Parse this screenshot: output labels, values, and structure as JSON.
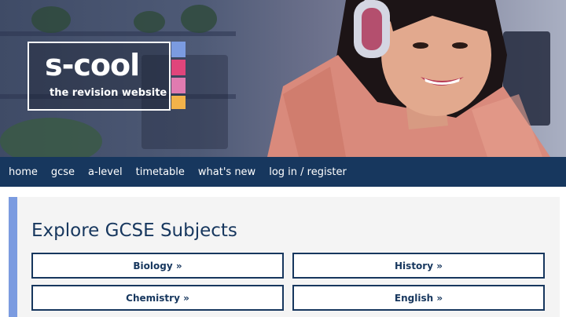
{
  "logo": {
    "name": "s-cool",
    "tagline": "the revision website",
    "strip_colors": [
      "#7b9be0",
      "#e0457b",
      "#e07bb0",
      "#f2b24a"
    ]
  },
  "nav": {
    "items": [
      "home",
      "gcse",
      "a-level",
      "timetable",
      "what's new",
      "log in / register"
    ]
  },
  "main": {
    "heading": "Explore GCSE Subjects",
    "subjects": [
      "Biology »",
      "History »",
      "Chemistry »",
      "English »"
    ]
  },
  "colors": {
    "nav_bg": "#17375e",
    "accent": "#7b9be0"
  }
}
